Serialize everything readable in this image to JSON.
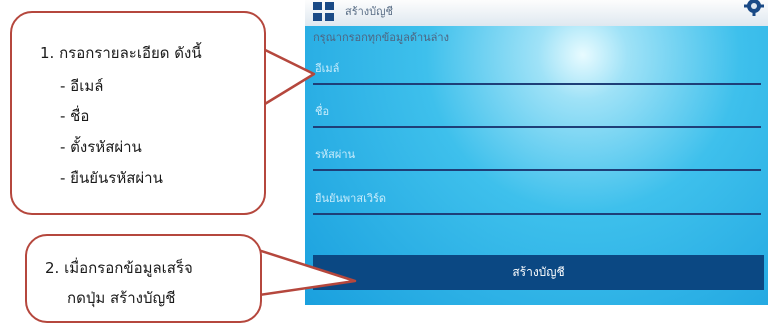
{
  "app": {
    "title": "สร้างบัญชี",
    "hint": "กรุณากรอกทุกข้อมูลด้านล่าง",
    "fields": [
      {
        "placeholder": "อีเมล์"
      },
      {
        "placeholder": "ชื่อ"
      },
      {
        "placeholder": "รหัสผ่าน"
      },
      {
        "placeholder": "ยืนยันพาสเวิร์ด"
      }
    ],
    "submit_label": "สร้างบัญชี"
  },
  "callout1": {
    "title": "1. กรอกรายละเอียด  ดังนี้",
    "items": [
      "- อีเมล์",
      "- ชื่อ",
      "- ตั้งรหัสผ่าน",
      "- ยืนยันรหัสผ่าน"
    ]
  },
  "callout2": {
    "line1": "2. เมื่อกรอกข้อมูลเสร็จ",
    "line2": "กดปุ่ม สร้างบัญชี"
  },
  "colors": {
    "callout_border": "#b5473d",
    "button": "#0b4883",
    "field_line": "#1e3f78"
  }
}
